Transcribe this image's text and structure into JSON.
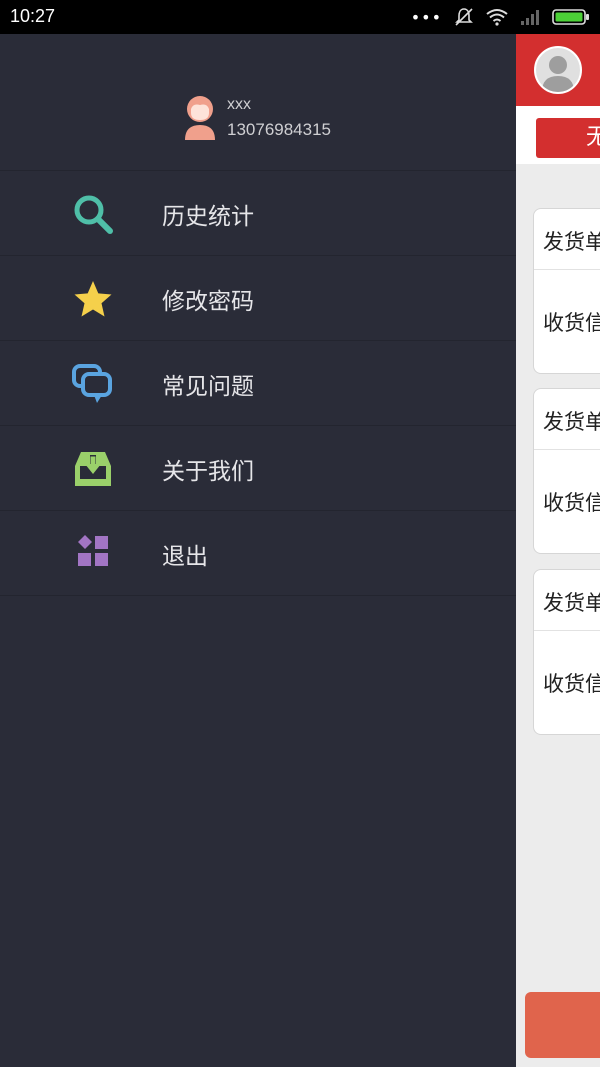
{
  "status_bar": {
    "time": "10:27",
    "icons": [
      "more-icon",
      "mute-icon",
      "wifi-icon",
      "signal-icon",
      "battery-icon"
    ]
  },
  "drawer": {
    "user": {
      "name": "xxx",
      "phone": "13076984315"
    },
    "menu": [
      {
        "label": "历史统计",
        "icon": "search-icon",
        "color": "#4fbfa8"
      },
      {
        "label": "修改密码",
        "icon": "star-icon",
        "color": "#f5d04b"
      },
      {
        "label": "常见问题",
        "icon": "chat-bubbles-icon",
        "color": "#5aa4e0"
      },
      {
        "label": "关于我们",
        "icon": "inbox-download-icon",
        "color": "#9ad06a"
      },
      {
        "label": "退出",
        "icon": "apps-icon",
        "color": "#a275c4"
      }
    ]
  },
  "main": {
    "header_color": "#d32f2f",
    "filter_button": "无",
    "cards": [
      {
        "line1": "发货单",
        "line2": "收货信"
      },
      {
        "line1": "发货单",
        "line2": "收货信"
      },
      {
        "line1": "发货单",
        "line2": "收货信"
      }
    ]
  }
}
